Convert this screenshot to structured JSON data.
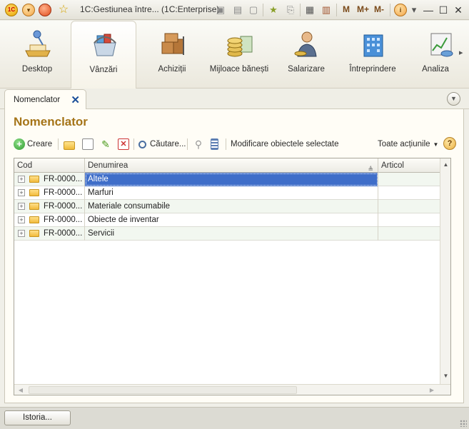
{
  "window": {
    "title": "1C:Gestiunea între... (1C:Enterprise)",
    "logo_text": "1C",
    "m_buttons": [
      "M",
      "M+",
      "M-"
    ],
    "info": "i",
    "controls": {
      "minimize": "—",
      "maximize": "☐",
      "close": "✕"
    }
  },
  "sections": [
    {
      "label": "Desktop",
      "icon": "desk-lamp-icon"
    },
    {
      "label": "Vânzări",
      "icon": "shopping-basket-icon",
      "active": true
    },
    {
      "label": "Achiziții",
      "icon": "cargo-boxes-icon"
    },
    {
      "label": "Mijloace bănești",
      "icon": "money-coins-icon"
    },
    {
      "label": "Salarizare",
      "icon": "employee-icon"
    },
    {
      "label": "Întreprindere",
      "icon": "building-icon"
    },
    {
      "label": "Analiza",
      "icon": "analysis-chart-icon"
    }
  ],
  "tab": {
    "label": "Nomenclator",
    "close": "✕"
  },
  "form": {
    "title": "Nomenclator",
    "toolbar": {
      "create": "Creare",
      "search": "Căutare...",
      "modify": "Modificare obiectele selectate",
      "all_actions": "Toate acțiunile",
      "help": "?"
    }
  },
  "table": {
    "columns": [
      "Cod",
      "Denumirea",
      "Articol"
    ],
    "rows": [
      {
        "code": "FR-0000...",
        "name": "Altele",
        "article": "",
        "selected": true
      },
      {
        "code": "FR-0000...",
        "name": "Marfuri",
        "article": ""
      },
      {
        "code": "FR-0000...",
        "name": "Materiale consumabile",
        "article": ""
      },
      {
        "code": "FR-0000...",
        "name": "Obiecte de inventar",
        "article": ""
      },
      {
        "code": "FR-0000...",
        "name": "Servicii",
        "article": ""
      }
    ]
  },
  "footer": {
    "history": "Istoria..."
  },
  "colors": {
    "accent_title": "#a57418",
    "selection": "#3f6ec9"
  }
}
